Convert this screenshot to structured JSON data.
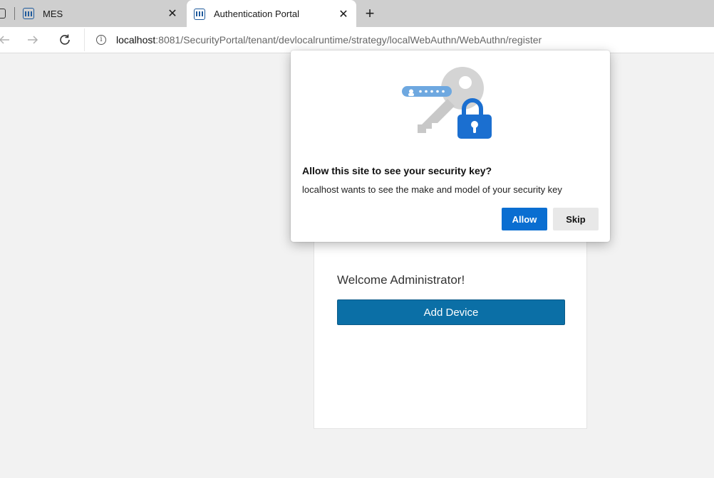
{
  "browser": {
    "tabs": [
      {
        "title": "MES",
        "favicon": "app-grid-icon",
        "active": false
      },
      {
        "title": "Authentication Portal",
        "favicon": "app-grid-icon",
        "active": true
      }
    ],
    "close_glyph": "✕",
    "new_tab_glyph": "+",
    "address": {
      "host": "localhost",
      "rest": ":8081/SecurityPortal/tenant/devlocalruntime/strategy/localWebAuthn/WebAuthn/register"
    },
    "info_glyph": "i"
  },
  "page": {
    "welcome": "Welcome Administrator!",
    "add_device_label": "Add Device",
    "accent_color": "#0b6fa6"
  },
  "dialog": {
    "title": "Allow this site to see your security key?",
    "message": "localhost wants to see the make and model of your security key",
    "allow_label": "Allow",
    "skip_label": "Skip",
    "allow_color": "#0a6ed1",
    "illustration": "security-key-lock-illustration"
  }
}
